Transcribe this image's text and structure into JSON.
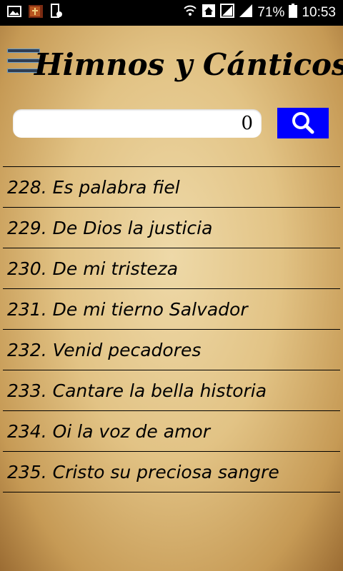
{
  "status": {
    "battery": "71%",
    "time": "10:53"
  },
  "header": {
    "title": "Himnos y Cánticos"
  },
  "search": {
    "value": "0"
  },
  "hymns": [
    "228. Es palabra fiel",
    "229. De Dios la justicia",
    "230. De mi tristeza",
    "231. De mi tierno Salvador",
    "232. Venid pecadores",
    "233. Cantare la bella historia",
    "234. Oi la voz de amor",
    "235. Cristo su preciosa sangre"
  ],
  "colors": {
    "search_button": "#0000ff",
    "status_bar": "#000000"
  },
  "icons": [
    "image-icon",
    "bible-app-icon",
    "device-icon",
    "wifi-icon",
    "home-icon",
    "signal-icon",
    "battery-icon",
    "menu-icon",
    "search-icon"
  ]
}
